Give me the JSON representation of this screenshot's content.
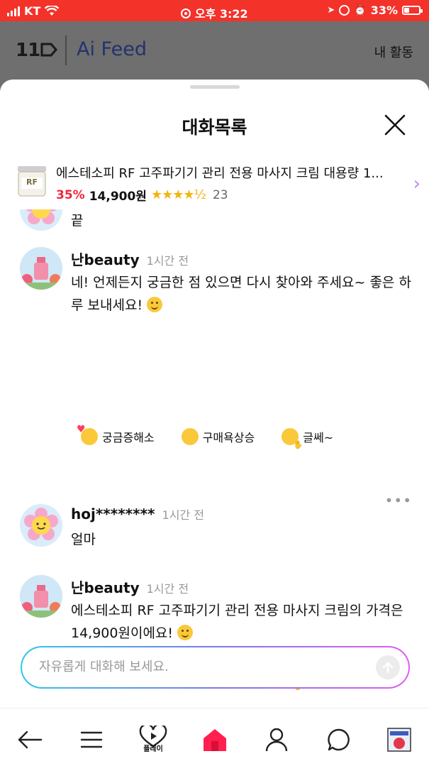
{
  "status_bar": {
    "carrier": "KT",
    "time": "오후 3:22",
    "battery": "33%",
    "battery_level": 0.33
  },
  "header": {
    "logo_11": "11",
    "logo_ai": "Ai Feed",
    "my_activity": "내 활동"
  },
  "sheet": {
    "title": "대화목록"
  },
  "product": {
    "name": "에스테소피 RF 고주파기기 관리 전용 마사지 크림 대용량 1...",
    "thumb_label": "RF",
    "discount": "35%",
    "price": "14,900원",
    "rating": 4.5,
    "stars": "★★★★½",
    "review_count": "23"
  },
  "messages": [
    {
      "kind": "user",
      "text": "끝"
    },
    {
      "kind": "bot",
      "name": "난beauty",
      "time": "1시간 전",
      "text": "네! 언제든지 궁금한 점 있으면 다시 찾아와 주세요~ 좋은 하루 보내세요!"
    },
    {
      "kind": "user",
      "name": "hoj********",
      "time": "1시간 전",
      "text": "얼마"
    },
    {
      "kind": "bot",
      "name": "난beauty",
      "time": "1시간 전",
      "text": "에스테소피 RF 고주파기기 관리 전용 마사지 크림의 가격은 14,900원이에요!"
    }
  ],
  "reactions": [
    "궁금증해소",
    "구매욕상승",
    "글쎄~"
  ],
  "input": {
    "placeholder": "자유롭게 대화해 보세요."
  },
  "nav": {
    "play_label": "플레이"
  },
  "colors": {
    "status_bar": "#f3322a",
    "accent_red": "#f0263b",
    "star": "#f5b40a",
    "gradient": [
      "#2fc6ec",
      "#7b79ee",
      "#e25bf5"
    ]
  }
}
